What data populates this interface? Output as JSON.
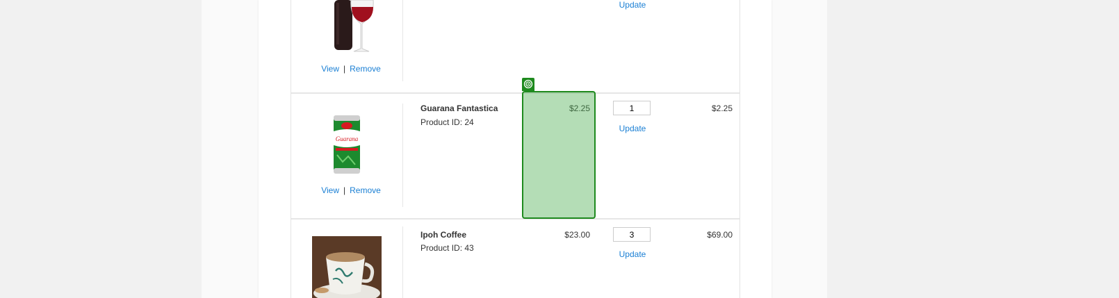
{
  "rows": [
    {
      "image": "wine-bottle-glass",
      "view_label": "View",
      "remove_label": "Remove",
      "update_label": "Update"
    },
    {
      "image": "guarana-can",
      "name": "Guarana Fantastica",
      "product_id": "Product ID: 24",
      "price": "$2.25",
      "quantity": "1",
      "update_label": "Update",
      "total": "$2.25",
      "view_label": "View",
      "remove_label": "Remove"
    },
    {
      "image": "coffee-cup",
      "name": "Ipoh Coffee",
      "product_id": "Product ID: 43",
      "price": "$23.00",
      "quantity": "3",
      "update_label": "Update",
      "total": "$69.00"
    }
  ],
  "separator": "|",
  "highlight": {
    "color": "#4caf50",
    "border": "#1e8a1e",
    "badge_icon": "target-icon"
  },
  "colors": {
    "link": "#1a7fd4"
  }
}
